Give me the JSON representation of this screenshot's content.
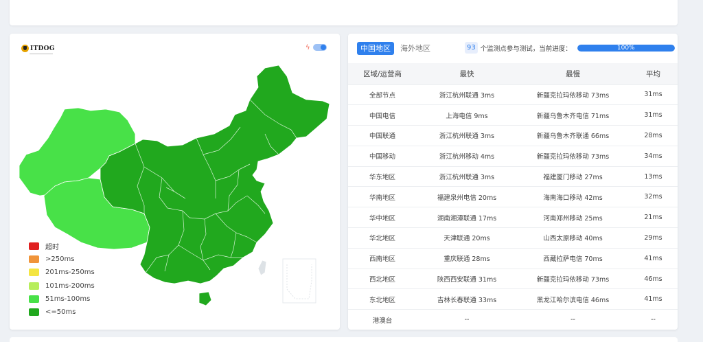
{
  "colors": {
    "accent": "#2f80ed",
    "timeout": "#e02020",
    "over250": "#f0943a",
    "ms201_250": "#f4e542",
    "ms101_200": "#b7ee5c",
    "ms51_100": "#48e148",
    "ms_le50": "#21a81e"
  },
  "map": {
    "logo_text": "ITDOG",
    "logo_icon": "dog-logo-icon",
    "toggle_icon": "lightning-icon",
    "legend": [
      {
        "label": "超时",
        "color": "#e02020"
      },
      {
        "label": ">250ms",
        "color": "#f0943a"
      },
      {
        "label": "201ms-250ms",
        "color": "#f4e542"
      },
      {
        "label": "101ms-200ms",
        "color": "#b7ee5c"
      },
      {
        "label": "51ms-100ms",
        "color": "#48e148"
      },
      {
        "label": "<=50ms",
        "color": "#21a81e"
      }
    ]
  },
  "tabs": [
    {
      "label": "中国地区",
      "active": true
    },
    {
      "label": "海外地区",
      "active": false
    }
  ],
  "progress": {
    "count": "93",
    "text": "个监测点参与测试，当前进度：",
    "percent_label": "100%",
    "percent": 100
  },
  "table": {
    "headers": [
      "区域/运营商",
      "最快",
      "最慢",
      "平均"
    ],
    "rows": [
      [
        "全部节点",
        "浙江杭州联通 3ms",
        "新疆克拉玛依移动 73ms",
        "31ms"
      ],
      [
        "中国电信",
        "上海电信 9ms",
        "新疆乌鲁木齐电信 71ms",
        "31ms"
      ],
      [
        "中国联通",
        "浙江杭州联通 3ms",
        "新疆乌鲁木齐联通 66ms",
        "28ms"
      ],
      [
        "中国移动",
        "浙江杭州移动 4ms",
        "新疆克拉玛依移动 73ms",
        "34ms"
      ],
      [
        "华东地区",
        "浙江杭州联通 3ms",
        "福建厦门移动 27ms",
        "13ms"
      ],
      [
        "华南地区",
        "福建泉州电信 20ms",
        "海南海口移动 42ms",
        "32ms"
      ],
      [
        "华中地区",
        "湖南湘潭联通 17ms",
        "河南郑州移动 25ms",
        "21ms"
      ],
      [
        "华北地区",
        "天津联通 20ms",
        "山西太原移动 40ms",
        "29ms"
      ],
      [
        "西南地区",
        "重庆联通 28ms",
        "西藏拉萨电信 70ms",
        "41ms"
      ],
      [
        "西北地区",
        "陕西西安联通 31ms",
        "新疆克拉玛依移动 73ms",
        "46ms"
      ],
      [
        "东北地区",
        "吉林长春联通 33ms",
        "黑龙江哈尔滨电信 46ms",
        "41ms"
      ],
      [
        "港澳台",
        "--",
        "--",
        "--"
      ]
    ]
  }
}
